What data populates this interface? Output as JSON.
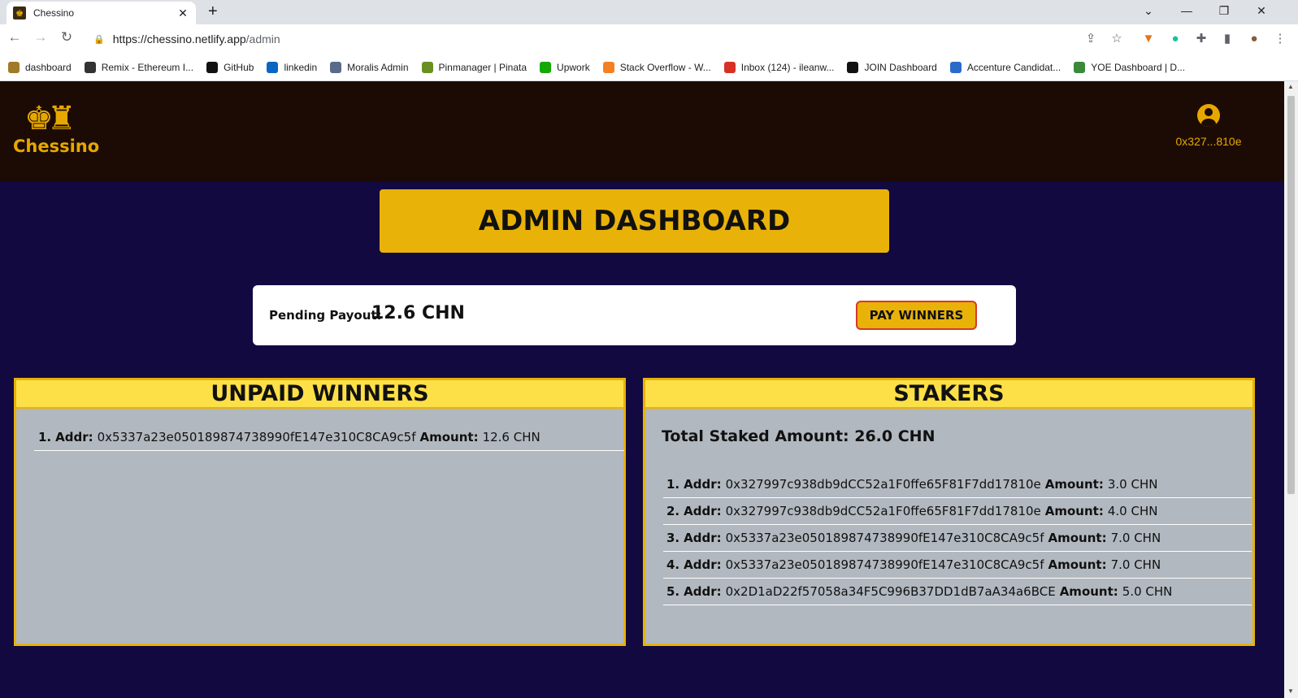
{
  "browser": {
    "tab_title": "Chessino",
    "tab_close": "✕",
    "new_tab": "+",
    "url_host": "https://chessino.netlify.app",
    "url_path": "/admin",
    "bookmarks": [
      {
        "label": "dashboard",
        "color": "#a07a2a"
      },
      {
        "label": "Remix - Ethereum I...",
        "color": "#333333"
      },
      {
        "label": "GitHub",
        "color": "#111111"
      },
      {
        "label": "linkedin",
        "color": "#0a66c2"
      },
      {
        "label": "Moralis Admin",
        "color": "#5a6a8a"
      },
      {
        "label": "Pinmanager | Pinata",
        "color": "#6b8e23"
      },
      {
        "label": "Upwork",
        "color": "#14a800"
      },
      {
        "label": "Stack Overflow - W...",
        "color": "#f48024"
      },
      {
        "label": "Inbox (124) - ileanw...",
        "color": "#d93025"
      },
      {
        "label": "JOIN Dashboard",
        "color": "#111111"
      },
      {
        "label": "Accenture Candidat...",
        "color": "#2a6acb"
      },
      {
        "label": "YOE Dashboard | D...",
        "color": "#3a8a3a"
      }
    ]
  },
  "app": {
    "logo_text": "Chessino",
    "logo_icon": "chess-king-rook-icon",
    "account_address": "0x327...810e",
    "page_title": "ADMIN DASHBOARD",
    "pending_payout_label": "Pending Payout:",
    "pending_payout_value": "12.6 CHN",
    "pay_button": "PAY WINNERS",
    "accent_color": "#e8b209",
    "unpaid": {
      "title": "UNPAID WINNERS",
      "rows": [
        {
          "idx": "1.",
          "addr_label": "Addr:",
          "addr": "0x5337a23e050189874738990fE147e310C8CA9c5f",
          "amount_label": "Amount:",
          "amount": "12.6 CHN"
        }
      ]
    },
    "stakers": {
      "title": "STAKERS",
      "total": "Total Staked Amount: 26.0 CHN",
      "rows": [
        {
          "idx": "1.",
          "addr_label": "Addr:",
          "addr": "0x327997c938db9dCC52a1F0ffe65F81F7dd17810e",
          "amount_label": "Amount:",
          "amount": "3.0 CHN"
        },
        {
          "idx": "2.",
          "addr_label": "Addr:",
          "addr": "0x327997c938db9dCC52a1F0ffe65F81F7dd17810e",
          "amount_label": "Amount:",
          "amount": "4.0 CHN"
        },
        {
          "idx": "3.",
          "addr_label": "Addr:",
          "addr": "0x5337a23e050189874738990fE147e310C8CA9c5f",
          "amount_label": "Amount:",
          "amount": "7.0 CHN"
        },
        {
          "idx": "4.",
          "addr_label": "Addr:",
          "addr": "0x5337a23e050189874738990fE147e310C8CA9c5f",
          "amount_label": "Amount:",
          "amount": "7.0 CHN"
        },
        {
          "idx": "5.",
          "addr_label": "Addr:",
          "addr": "0x2D1aD22f57058a34F5C996B37DD1dB7aA34a6BCE",
          "amount_label": "Amount:",
          "amount": "5.0 CHN"
        }
      ]
    }
  }
}
